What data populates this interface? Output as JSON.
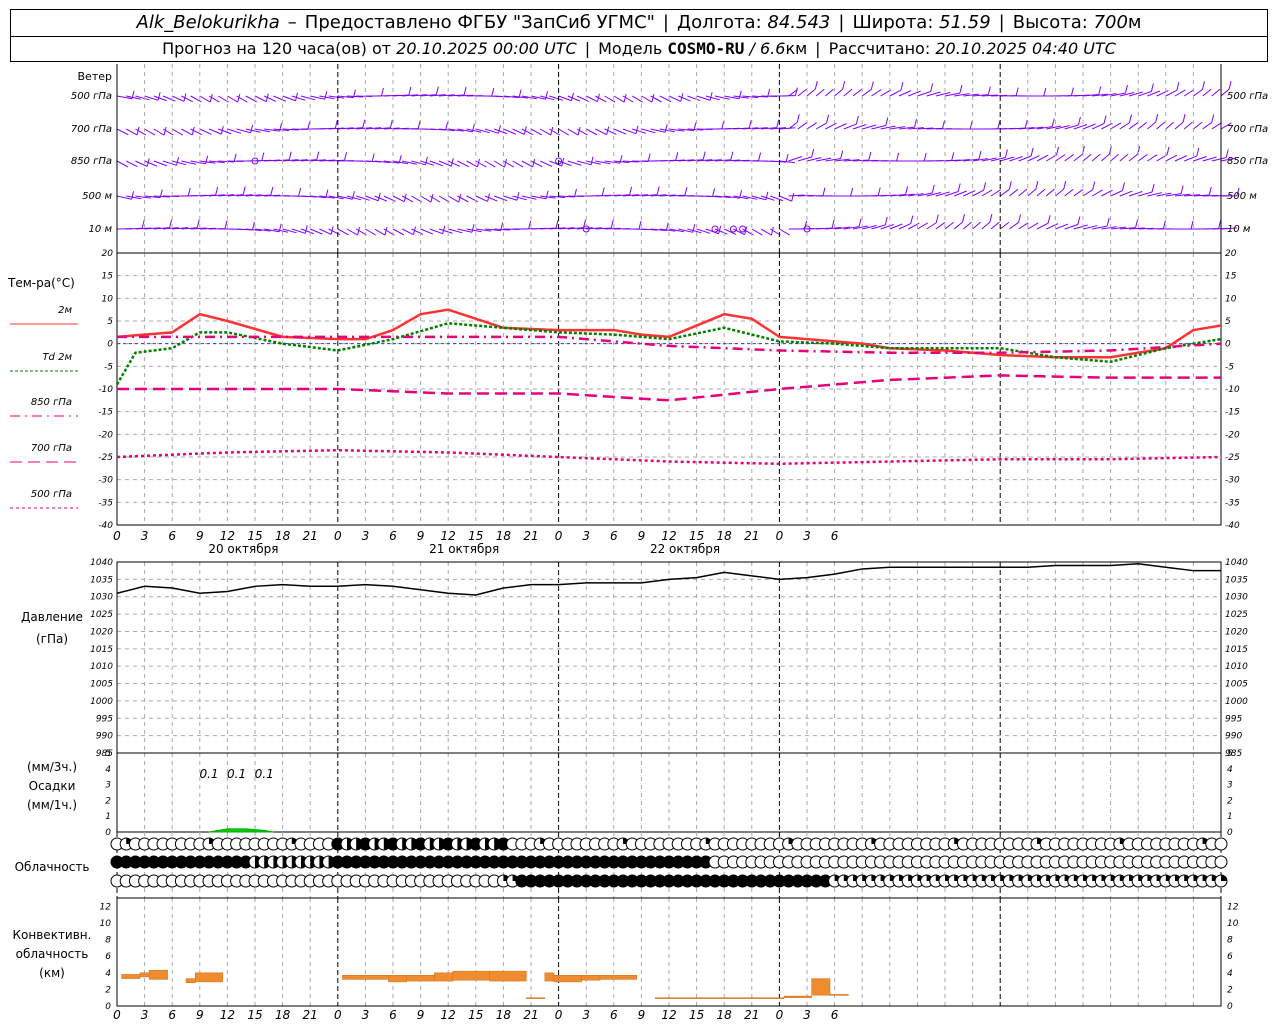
{
  "header": {
    "station": "Alk_Belokurikha",
    "dash": "–",
    "provider": "Предоставлено ФГБУ \"ЗапСиб УГМС\"",
    "lon_label": "Долгота:",
    "lon_value": "84.543",
    "lat_label": "Широта:",
    "lat_value": "51.59",
    "alt_label": "Высота:",
    "alt_value": "700",
    "alt_unit": "м",
    "forecast_label": "Прогноз на 120 часа(ов) от",
    "forecast_start": "20.10.2025 00:00 UTC",
    "model_label": "Модель",
    "model_name": "COSMO-RU",
    "model_res": "/ 6.6",
    "model_res_unit": "км",
    "calc_label": "Рассчитано:",
    "calc_time": "20.10.2025 04:40 UTC"
  },
  "x_axis": {
    "hour_labels": [
      "0",
      "3",
      "6",
      "9",
      "12",
      "15",
      "18",
      "21",
      "0",
      "3",
      "6",
      "9",
      "12",
      "15",
      "18",
      "21",
      "0",
      "3",
      "6",
      "9",
      "12",
      "15",
      "18",
      "21",
      "0",
      "3",
      "6"
    ],
    "day_labels": [
      "20 октября",
      "21 октября",
      "22 октября"
    ]
  },
  "wind_panel": {
    "title": "Ветер",
    "levels": [
      "500 гПа",
      "700 гПа",
      "850 гПа",
      "500 м",
      "10  м"
    ]
  },
  "temp_panel": {
    "title": "Тем-ра(°С)",
    "legend": [
      {
        "label": "2м",
        "color": "#ff3333",
        "dash": ""
      },
      {
        "label": "Td  2м",
        "color": "#008000",
        "dash": "3,2"
      },
      {
        "label": "850 гПа",
        "color": "#e6007e",
        "dash": "10,5,2,5"
      },
      {
        "label": "700 гПа",
        "color": "#e6007e",
        "dash": "12,6"
      },
      {
        "label": "500 гПа",
        "color": "#e6007e",
        "dash": "3,3"
      }
    ],
    "y_ticks": [
      "20",
      "15",
      "10",
      "5",
      "0",
      "-5",
      "-10",
      "-15",
      "-20",
      "-25",
      "-30",
      "-35",
      "-40"
    ]
  },
  "pressure_panel": {
    "title_line1": "Давление",
    "title_line2": "(гПа)",
    "y_ticks": [
      "1040",
      "1035",
      "1030",
      "1025",
      "1020",
      "1015",
      "1010",
      "1005",
      "1000",
      "995",
      "990",
      "985"
    ]
  },
  "precip_panel": {
    "unit_3h": "(мм/3ч.)",
    "title": "Осадки",
    "unit_1h": "(мм/1ч.)",
    "y_ticks": [
      "5",
      "4",
      "3",
      "2",
      "1",
      "0"
    ],
    "amount_labels": [
      "0.1",
      "0.1",
      "0.1"
    ]
  },
  "cloud_panel": {
    "title": "Облачность"
  },
  "conv_panel": {
    "title_line1": "Конвективн.",
    "title_line2": "облачность",
    "title_line3": "(км)",
    "y_ticks": [
      "12",
      "10",
      "8",
      "6",
      "4",
      "2",
      "0"
    ]
  },
  "chart_data": [
    {
      "type": "line",
      "panel": "temperature",
      "ylabel": "Тем-ра(°С)",
      "x_unit": "hours since 20.10.2025 00:00 UTC",
      "ylim": [
        -40,
        20
      ],
      "series": [
        {
          "name": "2м",
          "color": "#ff3333",
          "x": [
            0,
            6,
            9,
            12,
            18,
            24,
            27,
            30,
            33,
            36,
            42,
            48,
            54,
            57,
            60,
            63,
            66,
            69,
            72,
            75,
            78,
            81,
            84,
            90,
            96,
            102,
            108,
            114,
            117,
            120
          ],
          "y": [
            1.5,
            2.5,
            6.5,
            5,
            1.5,
            1,
            1,
            3,
            6.5,
            7.5,
            3.5,
            3,
            3,
            2,
            1.5,
            4,
            6.5,
            5.5,
            1.5,
            1,
            0.5,
            0,
            -1,
            -1.5,
            -2.5,
            -3,
            -3,
            -1,
            3,
            4
          ]
        },
        {
          "name": "Td 2м",
          "color": "#008000",
          "x": [
            0,
            2,
            6,
            9,
            12,
            18,
            24,
            30,
            36,
            42,
            48,
            54,
            60,
            66,
            72,
            78,
            84,
            96,
            102,
            108,
            114,
            120
          ],
          "y": [
            -9,
            -2,
            -1,
            2.5,
            2.5,
            0,
            -1.5,
            1,
            4.5,
            3.5,
            2.5,
            2,
            1,
            3.5,
            0.5,
            0,
            -1,
            -1,
            -3,
            -4,
            -1,
            1
          ]
        },
        {
          "name": "850 гПа",
          "color": "#e6007e",
          "x": [
            0,
            12,
            24,
            36,
            48,
            60,
            72,
            84,
            96,
            108,
            120
          ],
          "y": [
            1.5,
            1.5,
            1.5,
            1.5,
            1.5,
            -0.5,
            -1.5,
            -2,
            -2,
            -1.5,
            0
          ]
        },
        {
          "name": "700 гПа",
          "color": "#e6007e",
          "x": [
            0,
            12,
            24,
            36,
            48,
            60,
            72,
            84,
            96,
            108,
            120
          ],
          "y": [
            -10,
            -10,
            -10,
            -11,
            -11,
            -12.5,
            -10,
            -8,
            -7,
            -7.5,
            -7.5
          ]
        },
        {
          "name": "500 гПа",
          "color": "#e6007e",
          "x": [
            0,
            12,
            24,
            36,
            48,
            60,
            72,
            84,
            96,
            108,
            120
          ],
          "y": [
            -25,
            -24,
            -23.5,
            -24,
            -25,
            -26,
            -26.5,
            -26,
            -25.5,
            -25.5,
            -25
          ]
        }
      ]
    },
    {
      "type": "line",
      "panel": "pressure",
      "ylabel": "Давление (гПа)",
      "x_unit": "hours since 20.10.2025 00:00 UTC",
      "ylim": [
        985,
        1040
      ],
      "series": [
        {
          "x": [
            0,
            3,
            6,
            9,
            12,
            15,
            18,
            21,
            24,
            27,
            30,
            33,
            36,
            39,
            42,
            45,
            48,
            51,
            54,
            57,
            60,
            63,
            66,
            69,
            72,
            75,
            78,
            81,
            84,
            87,
            90,
            93,
            96,
            99,
            102,
            105,
            108,
            111,
            114,
            117,
            120
          ],
          "y": [
            1031,
            1033,
            1032.5,
            1031,
            1031.5,
            1033,
            1033.5,
            1033,
            1033,
            1033.5,
            1033,
            1032,
            1031,
            1030.5,
            1032.5,
            1033.5,
            1033.5,
            1034,
            1034,
            1034,
            1035,
            1035.5,
            1037,
            1036,
            1035,
            1035.5,
            1036.5,
            1038,
            1038.5,
            1038.5,
            1038.5,
            1038.5,
            1038.5,
            1038.5,
            1039,
            1039,
            1039,
            1039.5,
            1038.5,
            1037.5,
            1037.5
          ]
        }
      ]
    },
    {
      "type": "area",
      "panel": "precipitation",
      "ylabel": "Осадки (мм/1ч.)",
      "ylim": [
        0,
        5
      ],
      "series": [
        {
          "x": [
            10,
            11,
            12,
            13,
            14,
            15,
            16,
            17
          ],
          "y": [
            0,
            0.1,
            0.2,
            0.2,
            0.2,
            0.15,
            0.1,
            0
          ]
        }
      ],
      "labels_3h": [
        {
          "x": 10,
          "text": "0.1"
        },
        {
          "x": 13,
          "text": "0.1"
        },
        {
          "x": 16,
          "text": "0.1"
        }
      ]
    },
    {
      "type": "bar",
      "panel": "convective_clouds",
      "ylabel": "Конвективн. облачность (км)",
      "ylim": [
        0,
        13
      ],
      "bars": [
        {
          "x": [
            0.5,
            2.5
          ],
          "base": 3.3,
          "top": 3.8
        },
        {
          "x": [
            2.5,
            3.5
          ],
          "base": 3.5,
          "top": 4.0
        },
        {
          "x": [
            3.5,
            5.5
          ],
          "base": 3.2,
          "top": 4.3
        },
        {
          "x": [
            7.5,
            8.5
          ],
          "base": 2.8,
          "top": 3.3
        },
        {
          "x": [
            8.5,
            11.5
          ],
          "base": 2.9,
          "top": 4.0
        },
        {
          "x": [
            24.5,
            29.5
          ],
          "base": 3.2,
          "top": 3.7
        },
        {
          "x": [
            29.5,
            31.5
          ],
          "base": 2.9,
          "top": 3.7
        },
        {
          "x": [
            31.5,
            34.5
          ],
          "base": 3.0,
          "top": 3.7
        },
        {
          "x": [
            34.5,
            36.5
          ],
          "base": 3.0,
          "top": 4.0
        },
        {
          "x": [
            36.5,
            40.5
          ],
          "base": 3.1,
          "top": 4.2
        },
        {
          "x": [
            40.5,
            44.5
          ],
          "base": 3.0,
          "top": 4.2
        },
        {
          "x": [
            44.5,
            46.5
          ],
          "base": 0.9,
          "top": 1.0
        },
        {
          "x": [
            46.5,
            47.5
          ],
          "base": 3.0,
          "top": 4.0
        },
        {
          "x": [
            47.5,
            50.5
          ],
          "base": 2.9,
          "top": 3.7
        },
        {
          "x": [
            50.5,
            52.5
          ],
          "base": 3.1,
          "top": 3.7
        },
        {
          "x": [
            52.5,
            56.5
          ],
          "base": 3.2,
          "top": 3.7
        },
        {
          "x": [
            58.5,
            72.5
          ],
          "base": 0.9,
          "top": 1.0
        },
        {
          "x": [
            72.5,
            75.5
          ],
          "base": 1.0,
          "top": 1.2
        },
        {
          "x": [
            75.5,
            77.5
          ],
          "base": 1.3,
          "top": 3.3
        },
        {
          "x": [
            77.5,
            79.5
          ],
          "base": 1.3,
          "top": 1.4
        }
      ]
    }
  ]
}
